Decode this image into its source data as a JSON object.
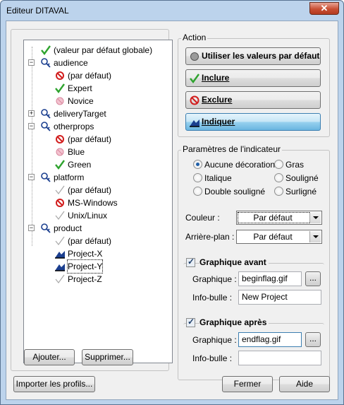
{
  "window": {
    "title": "Editeur DITAVAL",
    "close_glyph": "✕"
  },
  "tree": {
    "items": [
      {
        "label": "(valeur par défaut globale)",
        "icon": "check-icon",
        "level": 0,
        "expander": ""
      },
      {
        "label": "audience",
        "icon": "attribute-icon",
        "level": 0,
        "expander": "−"
      },
      {
        "label": "(par défaut)",
        "icon": "exclude-icon",
        "level": 1,
        "expander": ""
      },
      {
        "label": "Expert",
        "icon": "check-icon",
        "level": 1,
        "expander": ""
      },
      {
        "label": "Novice",
        "icon": "exclude-faded-icon",
        "level": 1,
        "expander": ""
      },
      {
        "label": "deliveryTarget",
        "icon": "attribute-icon",
        "level": 0,
        "expander": "+"
      },
      {
        "label": "otherprops",
        "icon": "attribute-icon",
        "level": 0,
        "expander": "−"
      },
      {
        "label": "(par défaut)",
        "icon": "exclude-icon",
        "level": 1,
        "expander": ""
      },
      {
        "label": "Blue",
        "icon": "exclude-faded-icon",
        "level": 1,
        "expander": ""
      },
      {
        "label": "Green",
        "icon": "check-icon",
        "level": 1,
        "expander": ""
      },
      {
        "label": "platform",
        "icon": "attribute-icon",
        "level": 0,
        "expander": "−"
      },
      {
        "label": "(par défaut)",
        "icon": "check-faded-icon",
        "level": 1,
        "expander": ""
      },
      {
        "label": "MS-Windows",
        "icon": "exclude-icon",
        "level": 1,
        "expander": ""
      },
      {
        "label": "Unix/Linux",
        "icon": "check-faded-icon",
        "level": 1,
        "expander": ""
      },
      {
        "label": "product",
        "icon": "attribute-icon",
        "level": 0,
        "expander": "−"
      },
      {
        "label": "(par défaut)",
        "icon": "check-faded-icon",
        "level": 1,
        "expander": ""
      },
      {
        "label": "Project-X",
        "icon": "flag-icon",
        "level": 1,
        "expander": ""
      },
      {
        "label": "Project-Y",
        "icon": "flag-icon",
        "level": 1,
        "expander": ""
      },
      {
        "label": "Project-Z",
        "icon": "check-faded-icon",
        "level": 1,
        "expander": ""
      }
    ],
    "add_label": "Ajouter...",
    "delete_label": "Supprimer..."
  },
  "action": {
    "legend": "Action",
    "use_defaults": "Utiliser les valeurs par défaut",
    "include": "Inclure",
    "exclude": "Exclure",
    "flag": "Indiquer"
  },
  "indicator": {
    "legend": "Paramètres de l'indicateur",
    "styles": {
      "none": "Aucune décoration",
      "italic": "Italique",
      "double_underline": "Double souligné",
      "bold": "Gras",
      "underline": "Souligné",
      "overline": "Surligné"
    },
    "color_label": "Couleur :",
    "color_value": "Par défaut",
    "background_label": "Arrière-plan :",
    "background_value": "Par défaut",
    "before": {
      "title": "Graphique avant",
      "graphic_label": "Graphique :",
      "graphic_value": "beginflag.gif",
      "tooltip_label": "Info-bulle :",
      "tooltip_value": "New Project",
      "browse": "..."
    },
    "after": {
      "title": "Graphique après",
      "graphic_label": "Graphique :",
      "graphic_value": "endflag.gif",
      "tooltip_label": "Info-bulle :",
      "tooltip_value": "",
      "browse": "..."
    }
  },
  "footer": {
    "import": "Importer les profils...",
    "close": "Fermer",
    "help": "Aide"
  }
}
